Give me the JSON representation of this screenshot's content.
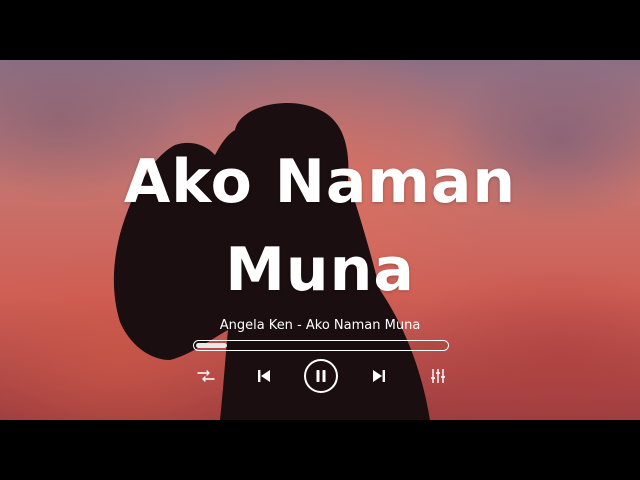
{
  "player": {
    "title_line1": "Ako Naman",
    "title_line2": "Muna",
    "song_label": "Angela Ken - Ako Naman Muna",
    "progress_fraction": 0.13
  },
  "controls": {
    "shuffle_icon": "shuffle-icon",
    "prev_icon": "skip-previous-icon",
    "play_pause_icon": "pause-icon",
    "next_icon": "skip-next-icon",
    "equalizer_icon": "equalizer-icon"
  },
  "colors": {
    "text": "#ffffff",
    "letterbox": "#000000",
    "sky_top": "#8c6f84",
    "sky_mid": "#cf5f55",
    "silhouette": "#1a0e10"
  }
}
